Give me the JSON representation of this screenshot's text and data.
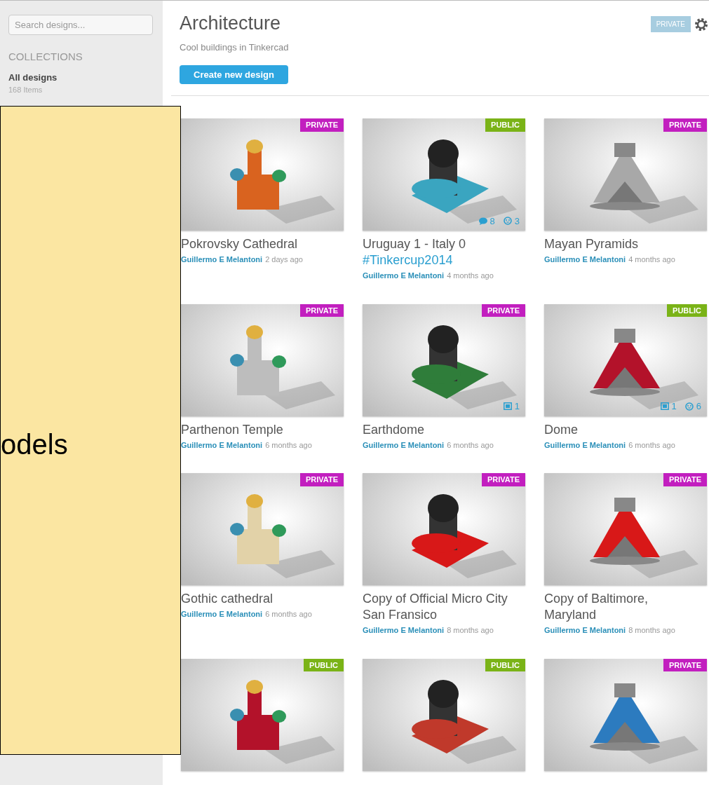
{
  "sidebar": {
    "search": {
      "placeholder": "Search designs..."
    },
    "collections_heading": "COLLECTIONS",
    "collections": [
      {
        "label": "All designs",
        "count": "168 Items",
        "selected": true
      }
    ]
  },
  "header": {
    "title": "Architecture",
    "subtitle": "Cool buildings in Tinkercad",
    "create_button": "Create new design",
    "visibility": "PRIVATE"
  },
  "cards": [
    {
      "title": "Pokrovsky Cathedral",
      "author": "Guillermo E Melantoni",
      "time": "2 days ago",
      "badge": {
        "label": "PRIVATE",
        "color": "#c21fbf"
      }
    },
    {
      "title": "Uruguay 1 - Italy 0",
      "tag": "#Tinkercup2014",
      "author": "Guillermo E Melantoni",
      "time": "4 months ago",
      "badge": {
        "label": "PUBLIC",
        "color": "#7ab317"
      },
      "stats": [
        {
          "kind": "comments",
          "value": "8"
        },
        {
          "kind": "likes",
          "value": "3"
        }
      ]
    },
    {
      "title": "Mayan Pyramids",
      "author": "Guillermo E Melantoni",
      "time": "4 months ago",
      "badge": {
        "label": "PRIVATE",
        "color": "#c21fbf"
      }
    },
    {
      "title": "Parthenon Temple",
      "author": "Guillermo E Melantoni",
      "time": "6 months ago",
      "badge": {
        "label": "PRIVATE",
        "color": "#c21fbf"
      }
    },
    {
      "title": "Earthdome",
      "author": "Guillermo E Melantoni",
      "time": "6 months ago",
      "badge": {
        "label": "PRIVATE",
        "color": "#c21fbf"
      },
      "stats": [
        {
          "kind": "designs",
          "value": "1"
        }
      ]
    },
    {
      "title": "Dome",
      "author": "Guillermo E Melantoni",
      "time": "6 months ago",
      "badge": {
        "label": "PUBLIC",
        "color": "#7ab317"
      },
      "stats": [
        {
          "kind": "designs",
          "value": "1"
        },
        {
          "kind": "likes",
          "value": "6"
        }
      ]
    },
    {
      "title": "Gothic cathedral",
      "author": "Guillermo E Melantoni",
      "time": "6 months ago",
      "badge": {
        "label": "PRIVATE",
        "color": "#c21fbf"
      }
    },
    {
      "title": "Copy of Official Micro City San Fransico",
      "author": "Guillermo E Melantoni",
      "time": "8 months ago",
      "badge": {
        "label": "PRIVATE",
        "color": "#c21fbf"
      }
    },
    {
      "title": "Copy of Baltimore, Maryland",
      "author": "Guillermo E Melantoni",
      "time": "8 months ago",
      "badge": {
        "label": "PRIVATE",
        "color": "#c21fbf"
      }
    },
    {
      "badge": {
        "label": "PUBLIC",
        "color": "#7ab317"
      }
    },
    {
      "badge": {
        "label": "PUBLIC",
        "color": "#7ab317"
      }
    },
    {
      "badge": {
        "label": "PRIVATE",
        "color": "#c21fbf"
      }
    }
  ],
  "overlay": {
    "text": "odels"
  }
}
